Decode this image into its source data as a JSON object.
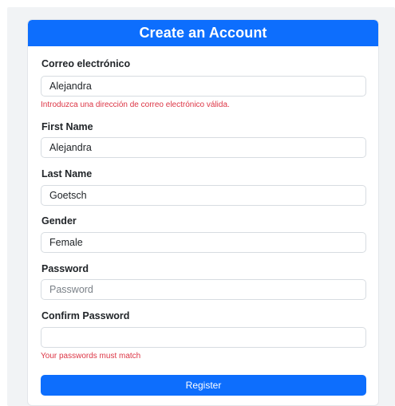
{
  "form": {
    "title": "Create an Account",
    "email": {
      "label": "Correo electrónico",
      "value": "Alejandra",
      "error": "Introduzca una dirección de correo electrónico válida."
    },
    "first_name": {
      "label": "First Name",
      "value": "Alejandra"
    },
    "last_name": {
      "label": "Last Name",
      "value": "Goetsch"
    },
    "gender": {
      "label": "Gender",
      "value": "Female"
    },
    "password": {
      "label": "Password",
      "value": "",
      "placeholder": "Password"
    },
    "confirm_password": {
      "label": "Confirm Password",
      "value": "",
      "error": "Your passwords must match"
    },
    "register_label": "Register"
  },
  "colors": {
    "primary": "#0d6efd",
    "error": "#dc3545",
    "background": "#f1f3f5"
  }
}
